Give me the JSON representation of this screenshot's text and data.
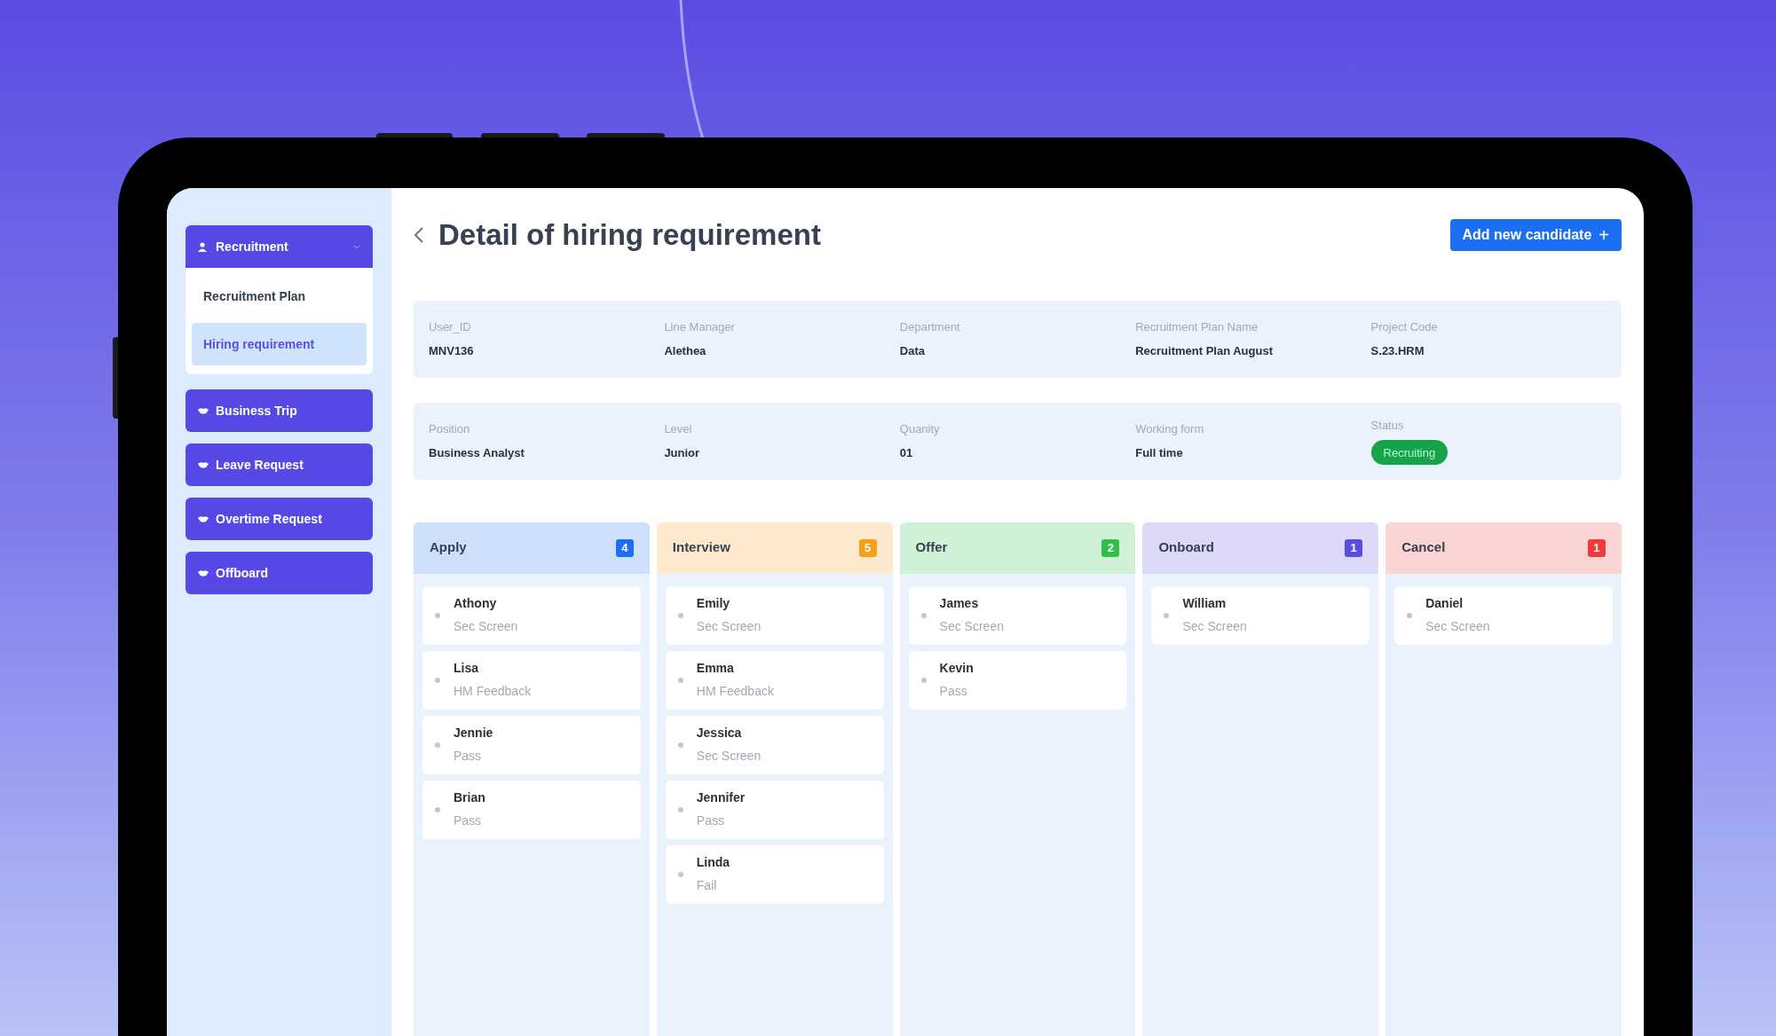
{
  "sidebar": {
    "groups": [
      {
        "label": "Recruitment",
        "kind": "person",
        "expanded": true,
        "children": [
          {
            "label": "Recruitment Plan",
            "selected": false
          },
          {
            "label": "Hiring requirement",
            "selected": true
          }
        ]
      },
      {
        "label": "Business Trip",
        "kind": "hand",
        "expanded": false
      },
      {
        "label": "Leave Request",
        "kind": "hand",
        "expanded": false
      },
      {
        "label": "Overtime Request",
        "kind": "hand",
        "expanded": false
      },
      {
        "label": "Offboard",
        "kind": "hand",
        "expanded": false
      }
    ]
  },
  "header": {
    "title": "Detail of hiring requirement",
    "action": {
      "label": "Add new candidate",
      "icon": "+"
    }
  },
  "info_rows": [
    [
      {
        "label": "User_ID",
        "value": "MNV136",
        "kind": "text"
      },
      {
        "label": "Line Manager",
        "value": "Alethea",
        "kind": "text"
      },
      {
        "label": "Department",
        "value": "Data",
        "kind": "text"
      },
      {
        "label": "Recruitment Plan Name",
        "value": "Recruitment Plan August",
        "kind": "text"
      },
      {
        "label": "Project Code",
        "value": "S.23.HRM",
        "kind": "text"
      }
    ],
    [
      {
        "label": "Position",
        "value": "Business Analyst",
        "kind": "text"
      },
      {
        "label": "Level",
        "value": "Junior",
        "kind": "text"
      },
      {
        "label": "Quanity",
        "value": "01",
        "kind": "text"
      },
      {
        "label": "Working form",
        "value": "Full time",
        "kind": "text"
      },
      {
        "label": "Status",
        "value": "Recruiting",
        "kind": "badge"
      }
    ]
  ],
  "board": {
    "columns": [
      {
        "title": "Apply",
        "count": "4",
        "color": "#1d6ff2",
        "cards": [
          {
            "name": "Athony",
            "stage": "Sec Screen"
          },
          {
            "name": "Lisa",
            "stage": "HM Feedback"
          },
          {
            "name": "Jennie",
            "stage": "Pass"
          },
          {
            "name": "Brian",
            "stage": "Pass"
          }
        ]
      },
      {
        "title": "Interview",
        "count": "5",
        "color": "#f5a01a",
        "cards": [
          {
            "name": "Emily",
            "stage": "Sec Screen"
          },
          {
            "name": "Emma",
            "stage": "HM Feedback"
          },
          {
            "name": "Jessica",
            "stage": "Sec Screen"
          },
          {
            "name": "Jennifer",
            "stage": "Pass"
          },
          {
            "name": "Linda",
            "stage": "Fail"
          }
        ]
      },
      {
        "title": "Offer",
        "count": "2",
        "color": "#2fbf4a",
        "cards": [
          {
            "name": "James",
            "stage": "Sec Screen"
          },
          {
            "name": "Kevin",
            "stage": "Pass"
          }
        ]
      },
      {
        "title": "Onboard",
        "count": "1",
        "color": "#5b4de0",
        "cards": [
          {
            "name": "William",
            "stage": "Sec Screen"
          }
        ]
      },
      {
        "title": "Cancel",
        "count": "1",
        "color": "#ef3b3b",
        "cards": [
          {
            "name": "Daniel",
            "stage": "Sec Screen"
          }
        ]
      }
    ]
  }
}
